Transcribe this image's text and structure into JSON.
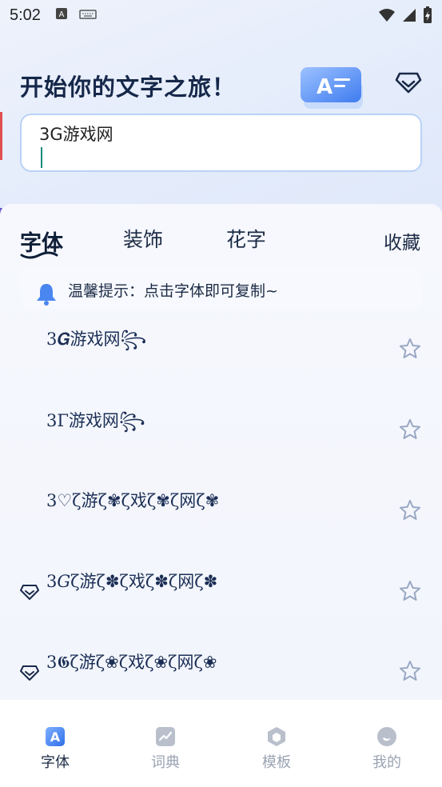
{
  "status_bar": {
    "time": "5:02"
  },
  "header": {
    "headline": "开始你的文字之旅！"
  },
  "input": {
    "value": "3G游戏网"
  },
  "tabs": [
    {
      "label": "字体"
    },
    {
      "label": "装饰"
    },
    {
      "label": "花字"
    },
    {
      "label": "收藏"
    }
  ],
  "tip": {
    "text": "温馨提示：点击字体即可复制~"
  },
  "font_results": [
    {
      "text": "3𝑮游戏网꧂"
    },
    {
      "text": "3Γ游戏网꧂"
    },
    {
      "text": "3♡ζ游ζ✾ζ戏ζ✾ζ网ζ✾"
    },
    {
      "text": "3𝐺ζ游ζ✽ζ戏ζ✽ζ网ζ✽"
    },
    {
      "text": "3𝕲ζ游ζ❀ζ戏ζ❀ζ网ζ❀"
    }
  ],
  "bottom_nav": [
    {
      "label": "字体"
    },
    {
      "label": "词典"
    },
    {
      "label": "模板"
    },
    {
      "label": "我的"
    }
  ],
  "colors": {
    "accent": "#3b82f6",
    "text_dark": "#16284a",
    "inactive": "#9aa3b2"
  }
}
